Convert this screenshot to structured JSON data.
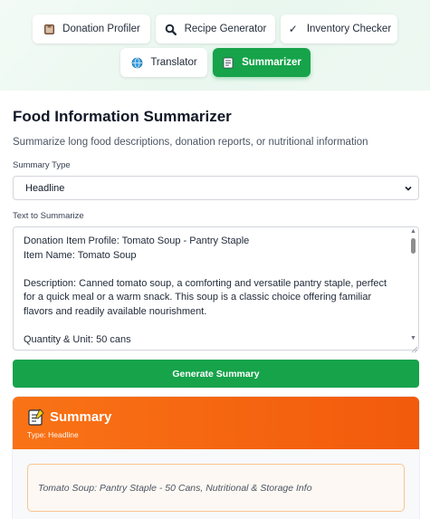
{
  "tabs": [
    {
      "label": "Donation Profiler",
      "icon": "box-icon",
      "active": false
    },
    {
      "label": "Recipe Generator",
      "icon": "magnifier-icon",
      "active": false
    },
    {
      "label": "Inventory Checker",
      "icon": "check-icon",
      "glyph": "✓",
      "active": false
    },
    {
      "label": "Translator",
      "icon": "globe-icon",
      "active": false
    },
    {
      "label": "Summarizer",
      "icon": "memo-icon",
      "active": true
    }
  ],
  "colors": {
    "accent": "#16a34a",
    "summary_header": "#f97316"
  },
  "page": {
    "title": "Food Information Summarizer",
    "subtitle": "Summarize long food descriptions, donation reports, or nutritional information"
  },
  "form": {
    "summary_type_label": "Summary Type",
    "summary_type_value": "Headline",
    "text_label": "Text to Summarize",
    "text_value": "Donation Item Profile: Tomato Soup - Pantry Staple\nItem Name: Tomato Soup\n\nDescription: Canned tomato soup, a comforting and versatile pantry staple, perfect for a quick meal or a warm snack. This soup is a classic choice offering familiar flavors and readily available nourishment.\n\nQuantity & Unit: 50 cans",
    "generate_label": "Generate Summary"
  },
  "summary": {
    "title": "Summary",
    "type_line": "Type: Headline",
    "result": "Tomato Soup: Pantry Staple - 50 Cans, Nutritional & Storage Info"
  }
}
